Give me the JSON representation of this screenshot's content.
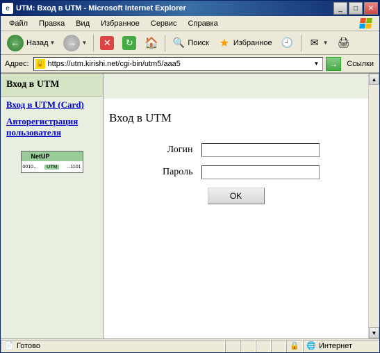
{
  "window": {
    "title": "UTM: Вход в UTM - Microsoft Internet Explorer"
  },
  "menubar": {
    "file": "Файл",
    "edit": "Правка",
    "view": "Вид",
    "favorites": "Избранное",
    "tools": "Сервис",
    "help": "Справка"
  },
  "toolbar": {
    "back": "Назад",
    "search": "Поиск",
    "favorites": "Избранное"
  },
  "address": {
    "label": "Адрес:",
    "url": "https://utm.kirishi.net/cgi-bin/utm5/aaa5",
    "links": "Ссылки"
  },
  "sidebar": {
    "heading": "Вход в UTM",
    "link_card": "Вход в UTM (Card)",
    "link_register": "Авторегистрация пользователя",
    "netup": {
      "brand": "NetUP",
      "code_left": "0010‥",
      "utm": "UTM",
      "code_right": "‥1101"
    }
  },
  "page": {
    "title": "Вход в UTM",
    "login_label": "Логин",
    "password_label": "Пароль",
    "ok": "OK"
  },
  "status": {
    "ready": "Готово",
    "zone": "Интернет"
  }
}
